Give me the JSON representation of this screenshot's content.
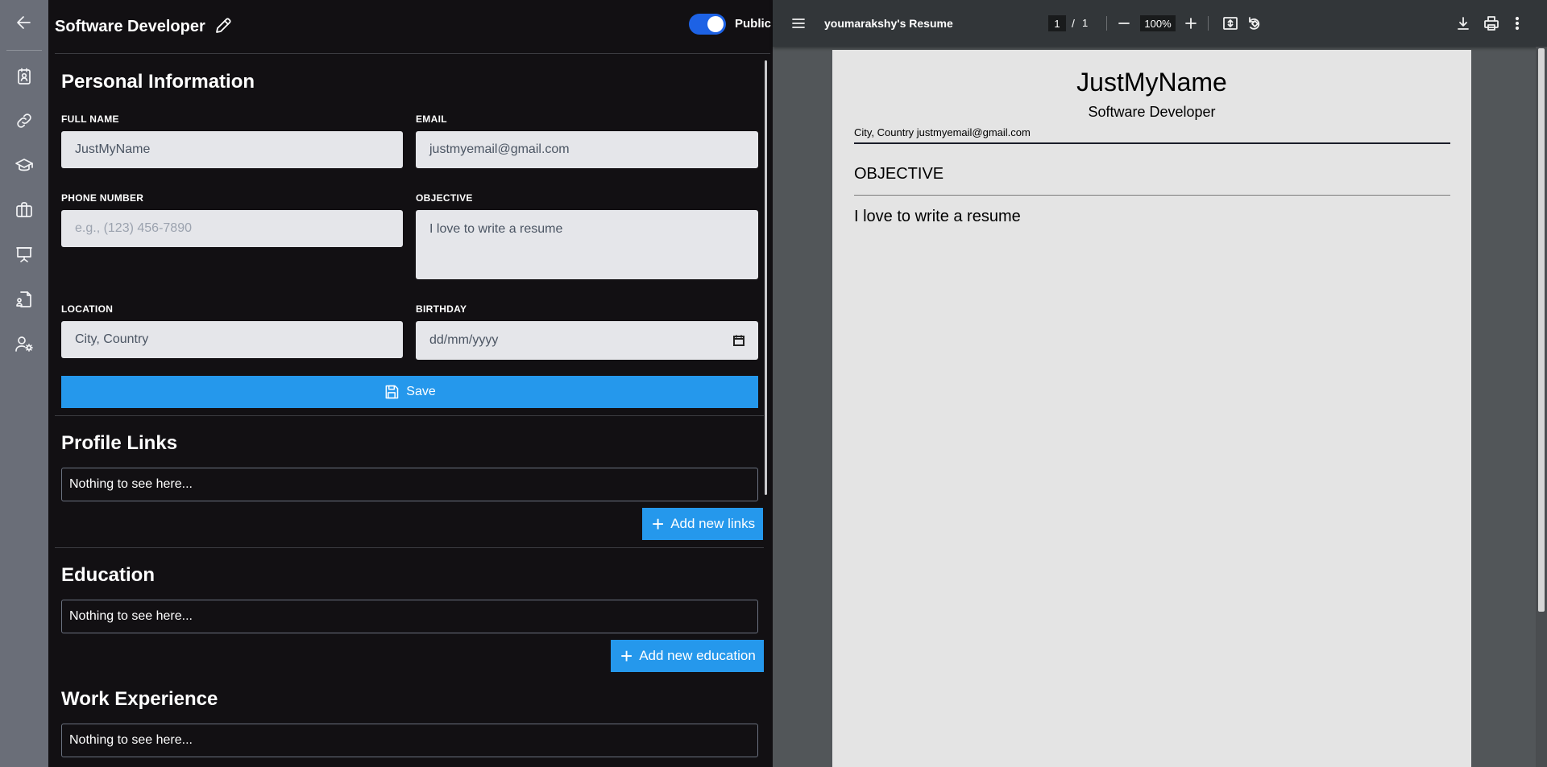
{
  "header": {
    "resume_title": "Software Developer",
    "visibility_label": "Public"
  },
  "personal": {
    "section_title": "Personal Information",
    "full_name_label": "FULL NAME",
    "full_name_value": "JustMyName",
    "email_label": "EMAIL",
    "email_value": "justmyemail@gmail.com",
    "phone_label": "PHONE NUMBER",
    "phone_placeholder": "e.g., (123) 456-7890",
    "objective_label": "OBJECTIVE",
    "objective_value": "I love to write a resume",
    "location_label": "LOCATION",
    "location_placeholder": "City, Country",
    "birthday_label": "BIRTHDAY",
    "birthday_placeholder": "dd/mm/yyyy",
    "save_label": "Save"
  },
  "profile_links": {
    "section_title": "Profile Links",
    "empty_text": "Nothing to see here...",
    "add_label": "Add new links"
  },
  "education": {
    "section_title": "Education",
    "empty_text": "Nothing to see here...",
    "add_label": "Add new education"
  },
  "work": {
    "section_title": "Work Experience",
    "empty_text": "Nothing to see here..."
  },
  "viewer": {
    "doc_title": "youmarakshy's Resume",
    "current_page": "1",
    "page_separator": "/",
    "total_pages": "1",
    "zoom": "100%"
  },
  "preview": {
    "name": "JustMyName",
    "role": "Software Developer",
    "contact": "City, Country justmyemail@gmail.com",
    "objective_heading": "OBJECTIVE",
    "objective_text": "I love to write a resume"
  },
  "rail_icons": [
    "back-arrow-icon",
    "contact-card-icon",
    "link-icon",
    "graduation-cap-icon",
    "briefcase-icon",
    "presentation-icon",
    "document-user-icon",
    "user-settings-icon"
  ],
  "colors": {
    "accent": "#2598ec",
    "toggle": "#1d62e5",
    "editor_bg": "#121013",
    "rail_bg": "#6a6e78",
    "viewer_bar": "#323639"
  }
}
